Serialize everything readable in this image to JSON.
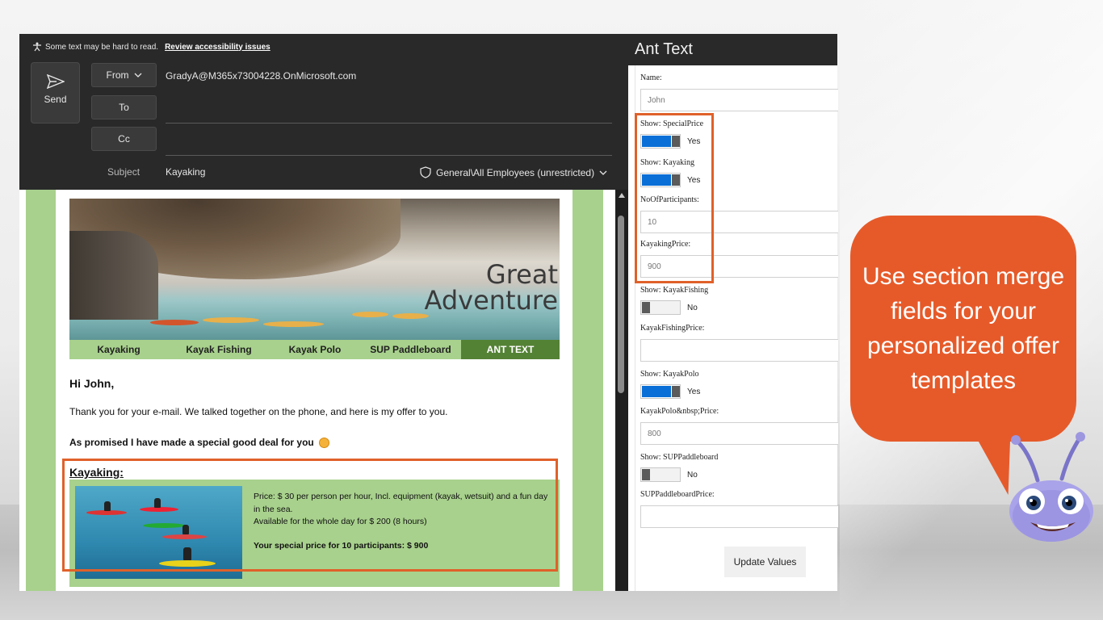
{
  "accessibility": {
    "notice": "Some text may be hard to read.",
    "link": "Review accessibility issues"
  },
  "compose": {
    "send_label": "Send",
    "from_label": "From",
    "to_label": "To",
    "cc_label": "Cc",
    "from_email": "GradyA@M365x73004228.OnMicrosoft.com",
    "subject_label": "Subject",
    "subject_value": "Kayaking",
    "sensitivity": "General\\All Employees (unrestricted)"
  },
  "email": {
    "banner_title_line1": "Great",
    "banner_title_line2": "Adventure",
    "nav": [
      "Kayaking",
      "Kayak Fishing",
      "Kayak Polo",
      "SUP Paddleboard",
      "ANT TEXT"
    ],
    "greeting": "Hi John,",
    "paragraph1": "Thank you for your e-mail. We talked together on the phone, and here is my offer to you.",
    "paragraph2": "As promised I have made a special good deal for you",
    "section_title": "Kayaking:",
    "offer_line1": "Price: $ 30 per person per hour, Incl. equipment (kayak, wetsuit) and a fun day in the sea.",
    "offer_line2": "Available for the whole day for $ 200 (8 hours)",
    "offer_special": "Your special price for 10 participants: $ 900"
  },
  "pane": {
    "title": "Ant Text",
    "name_label": "Name:",
    "name_value": "John",
    "show_special_label": "Show: SpecialPrice",
    "show_special_state": "Yes",
    "show_kayaking_label": "Show: Kayaking",
    "show_kayaking_state": "Yes",
    "participants_label": "NoOfParticipants:",
    "participants_value": "10",
    "kayaking_price_label": "KayakingPrice:",
    "kayaking_price_value": "900",
    "show_fishing_label": "Show: KayakFishing",
    "show_fishing_state": "No",
    "fishing_price_label": "KayakFishingPrice:",
    "fishing_price_value": "",
    "show_polo_label": "Show: KayakPolo",
    "show_polo_state": "Yes",
    "polo_price_label": "KayakPolo&nbsp;Price:",
    "polo_price_value": "800",
    "show_sup_label": "Show: SUPPaddleboard",
    "show_sup_state": "No",
    "sup_price_label": "SUPPaddleboardPrice:",
    "sup_price_value": "",
    "update_button": "Update Values"
  },
  "callout": {
    "text": "Use section merge fields for your personalized offer templates"
  },
  "colors": {
    "accent_orange": "#e65a2a",
    "nav_green": "#a8d18d",
    "nav_active": "#548235",
    "toggle_blue": "#0a6fd6"
  }
}
